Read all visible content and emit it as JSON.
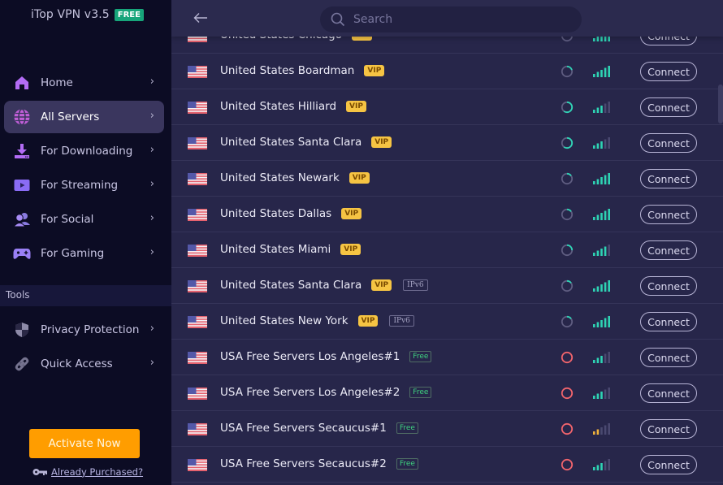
{
  "app": {
    "title": "iTop VPN v3.5",
    "edition_badge": "FREE"
  },
  "sidebar": {
    "nav": [
      {
        "label": "Home",
        "icon": "home-icon",
        "active": false
      },
      {
        "label": "All Servers",
        "icon": "globe-icon",
        "active": true
      },
      {
        "label": "For Downloading",
        "icon": "download-icon",
        "active": false
      },
      {
        "label": "For Streaming",
        "icon": "play-icon",
        "active": false
      },
      {
        "label": "For Social",
        "icon": "users-icon",
        "active": false
      },
      {
        "label": "For Gaming",
        "icon": "gamepad-icon",
        "active": false
      }
    ],
    "tools_header": "Tools",
    "tools": [
      {
        "label": "Privacy Protection",
        "icon": "shield-icon"
      },
      {
        "label": "Quick Access",
        "icon": "link-icon"
      }
    ],
    "chevron": "›",
    "activate_label": "Activate Now",
    "purchased_label": "Already Purchased?"
  },
  "search": {
    "placeholder": "Search",
    "value": ""
  },
  "servers": [
    {
      "name": "United States Chicago",
      "tags": [
        "VIP"
      ],
      "load": 0.2,
      "load_status": "normal",
      "signal": 5,
      "signal_color": "teal",
      "action": "Connect"
    },
    {
      "name": "United States Boardman",
      "tags": [
        "VIP"
      ],
      "load": 0.2,
      "load_status": "normal",
      "signal": 5,
      "signal_color": "teal",
      "action": "Connect"
    },
    {
      "name": "United States Hilliard",
      "tags": [
        "VIP"
      ],
      "load": 0.6,
      "load_status": "normal",
      "signal": 3,
      "signal_color": "teal",
      "action": "Connect"
    },
    {
      "name": "United States Santa Clara",
      "tags": [
        "VIP"
      ],
      "load": 0.6,
      "load_status": "normal",
      "signal": 3,
      "signal_color": "teal",
      "action": "Connect"
    },
    {
      "name": "United States Newark",
      "tags": [
        "VIP"
      ],
      "load": 0.15,
      "load_status": "normal",
      "signal": 5,
      "signal_color": "teal",
      "action": "Connect"
    },
    {
      "name": "United States Dallas",
      "tags": [
        "VIP"
      ],
      "load": 0.15,
      "load_status": "normal",
      "signal": 5,
      "signal_color": "teal",
      "action": "Connect"
    },
    {
      "name": "United States Miami",
      "tags": [
        "VIP"
      ],
      "load": 0.25,
      "load_status": "normal",
      "signal": 4,
      "signal_color": "teal",
      "action": "Connect"
    },
    {
      "name": "United States Santa Clara",
      "tags": [
        "VIP",
        "IPv6"
      ],
      "load": 0.15,
      "load_status": "normal",
      "signal": 5,
      "signal_color": "teal",
      "action": "Connect"
    },
    {
      "name": "United States New York",
      "tags": [
        "VIP",
        "IPv6"
      ],
      "load": 0.15,
      "load_status": "normal",
      "signal": 5,
      "signal_color": "teal",
      "action": "Connect"
    },
    {
      "name": "USA Free Servers Los Angeles#1",
      "tags": [
        "Free"
      ],
      "load": 1.0,
      "load_status": "full",
      "signal": 3,
      "signal_color": "teal",
      "action": "Connect"
    },
    {
      "name": "USA Free Servers Los Angeles#2",
      "tags": [
        "Free"
      ],
      "load": 1.0,
      "load_status": "full",
      "signal": 3,
      "signal_color": "teal",
      "action": "Connect"
    },
    {
      "name": "USA Free Servers Secaucus#1",
      "tags": [
        "Free"
      ],
      "load": 1.0,
      "load_status": "full",
      "signal": 2,
      "signal_color": "orange",
      "action": "Connect"
    },
    {
      "name": "USA Free Servers Secaucus#2",
      "tags": [
        "Free"
      ],
      "load": 1.0,
      "load_status": "full",
      "signal": 3,
      "signal_color": "teal",
      "action": "Connect"
    }
  ],
  "colors": {
    "accent_purple": "#a35bf0",
    "teal": "#2ed3b4",
    "orange_signal": "#f0b23c",
    "red_load": "#f0646c",
    "activate": "#ff9d00",
    "vip": "#f6c443",
    "free_tag": "#3fd37f"
  }
}
